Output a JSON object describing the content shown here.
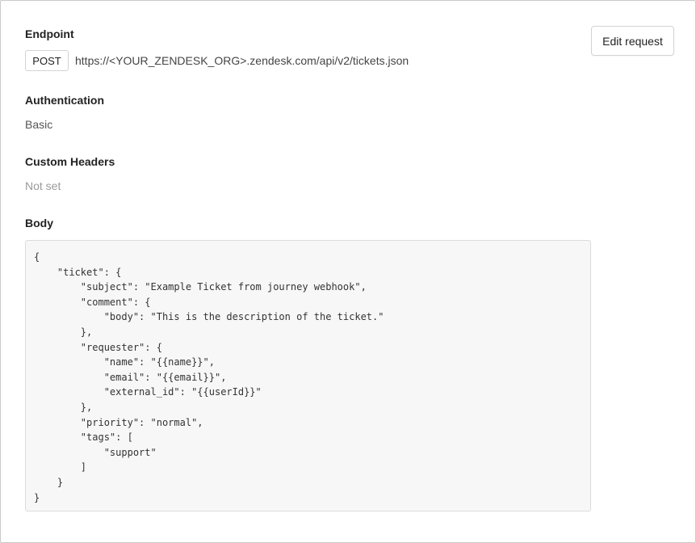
{
  "actions": {
    "edit_request_label": "Edit request"
  },
  "endpoint": {
    "label": "Endpoint",
    "method": "POST",
    "url": "https://<YOUR_ZENDESK_ORG>.zendesk.com/api/v2/tickets.json"
  },
  "authentication": {
    "label": "Authentication",
    "value": "Basic"
  },
  "custom_headers": {
    "label": "Custom Headers",
    "value": "Not set"
  },
  "body": {
    "label": "Body",
    "lines": [
      "{",
      "    \"ticket\": {",
      "        \"subject\": \"Example Ticket from journey webhook\",",
      "        \"comment\": {",
      "            \"body\": \"This is the description of the ticket.\"",
      "        },",
      "        \"requester\": {",
      "            \"name\": \"{{name}}\",",
      "            \"email\": \"{{email}}\",",
      "            \"external_id\": \"{{userId}}\"",
      "        },",
      "        \"priority\": \"normal\",",
      "        \"tags\": [",
      "            \"support\"",
      "        ]",
      "    }",
      "}"
    ]
  }
}
